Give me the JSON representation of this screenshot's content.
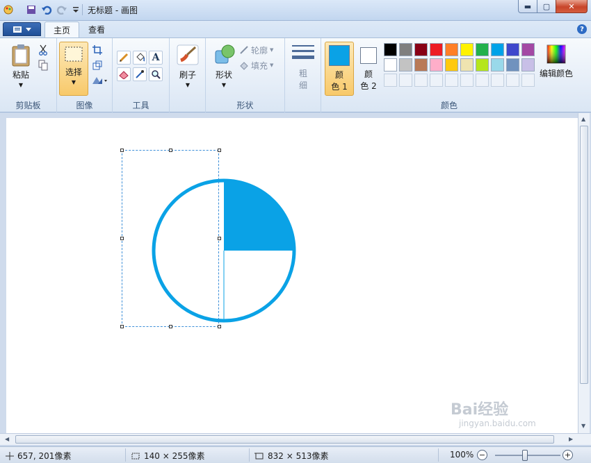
{
  "window": {
    "title": "无标题 - 画图",
    "controls": {
      "minimize": "▬",
      "maximize": "▢",
      "close": "✕"
    }
  },
  "tabs": [
    {
      "label": "主页",
      "active": true
    },
    {
      "label": "查看",
      "active": false
    }
  ],
  "ribbon": {
    "clipboard": {
      "paste_label": "粘贴",
      "group_label": "剪贴板"
    },
    "image": {
      "select_label": "选择",
      "group_label": "图像"
    },
    "tools": {
      "group_label": "工具",
      "text_glyph": "A"
    },
    "brushes": {
      "label": "刷子"
    },
    "shapes": {
      "label": "形状",
      "outline_label": "轮廓",
      "fill_label": "填充",
      "group_label": "形状"
    },
    "size": {
      "label_top": "粗",
      "label_bottom": "细"
    },
    "colors": {
      "color1_top": "颜",
      "color1_bottom": "色 1",
      "color2_top": "颜",
      "color2_bottom": "色 2",
      "edit_label": "编辑颜色",
      "group_label": "颜色",
      "color1_value": "#0aa2e6",
      "color2_value": "#ffffff",
      "palette_row1": [
        "#000000",
        "#7f7f7f",
        "#880015",
        "#ed1c24",
        "#ff7f27",
        "#fff200",
        "#22b14c",
        "#00a2e8",
        "#3f48cc",
        "#a349a4"
      ],
      "palette_row2": [
        "#ffffff",
        "#c3c3c3",
        "#b97a57",
        "#ffaec9",
        "#ffc90e",
        "#efe4b0",
        "#b5e61d",
        "#99d9ea",
        "#7092be",
        "#c8bfe7"
      ]
    }
  },
  "canvas": {
    "shape_color": "#0aa2e6",
    "background": "#ffffff"
  },
  "status": {
    "cursor_pos": "657, 201像素",
    "selection_size": "140 × 255像素",
    "image_size": "832 × 513像素",
    "zoom": "100%"
  },
  "watermark": {
    "main": "Bai经验",
    "sub": "jingyan.baidu.com"
  }
}
